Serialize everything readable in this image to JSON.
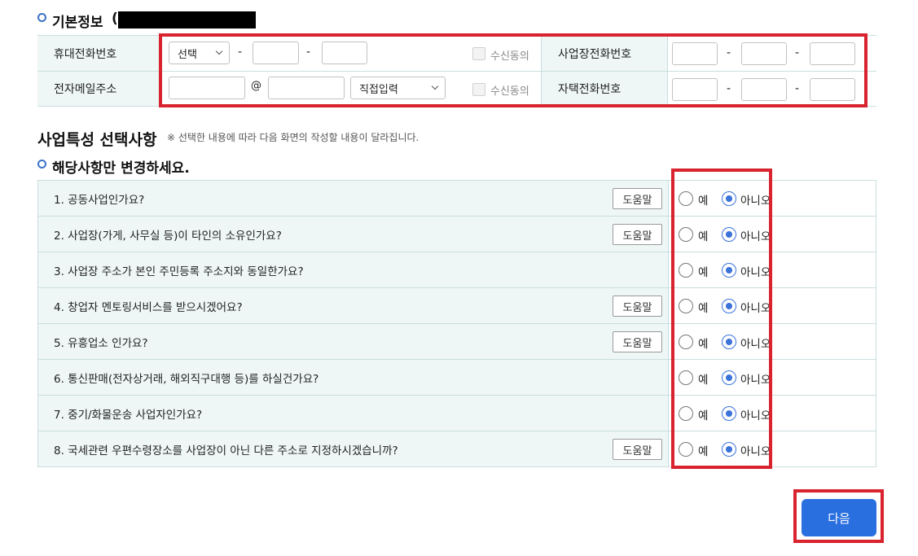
{
  "basic_info": {
    "section_title": "기본정보",
    "paren": "(",
    "mobile_label": "휴대전화번호",
    "mobile_prefix_select": "선택",
    "mobile_consent": "수신동의",
    "business_phone_label": "사업장전화번호",
    "email_label": "전자메일주소",
    "email_at": "@",
    "email_domain_select": "직접입력",
    "email_consent": "수신동의",
    "home_phone_label": "자택전화번호",
    "dash": "-"
  },
  "business": {
    "title": "사업특성 선택사항",
    "note": "※ 선택한 내용에 따라 다음 화면의 작성할 내용이 달라집니다.",
    "subsection_title": "해당사항만 변경하세요.",
    "help_label": "도움말",
    "yes_label": "예",
    "no_label": "아니오",
    "questions": [
      {
        "text": "1. 공동사업인가요?",
        "has_help": true,
        "answer": "no"
      },
      {
        "text": "2. 사업장(가게, 사무실 등)이 타인의 소유인가요?",
        "has_help": true,
        "answer": "no"
      },
      {
        "text": "3. 사업장 주소가 본인 주민등록 주소지와 동일한가요?",
        "has_help": false,
        "answer": "no"
      },
      {
        "text": "4. 창업자 멘토링서비스를 받으시겠어요?",
        "has_help": true,
        "answer": "no"
      },
      {
        "text": "5. 유흥업소 인가요?",
        "has_help": true,
        "answer": "no"
      },
      {
        "text": "6. 통신판매(전자상거래, 해외직구대행 등)를 하실건가요?",
        "has_help": false,
        "answer": "no"
      },
      {
        "text": "7. 중기/화물운송 사업자인가요?",
        "has_help": false,
        "answer": "no"
      },
      {
        "text": "8. 국세관련 우편수령장소를 사업장이 아닌 다른 주소로 지정하시겠습니까?",
        "has_help": true,
        "answer": "no"
      }
    ]
  },
  "next_button": "다음",
  "colors": {
    "accent": "#2a6fe0",
    "highlight": "#d9232e",
    "label_bg": "#eef7f6"
  }
}
